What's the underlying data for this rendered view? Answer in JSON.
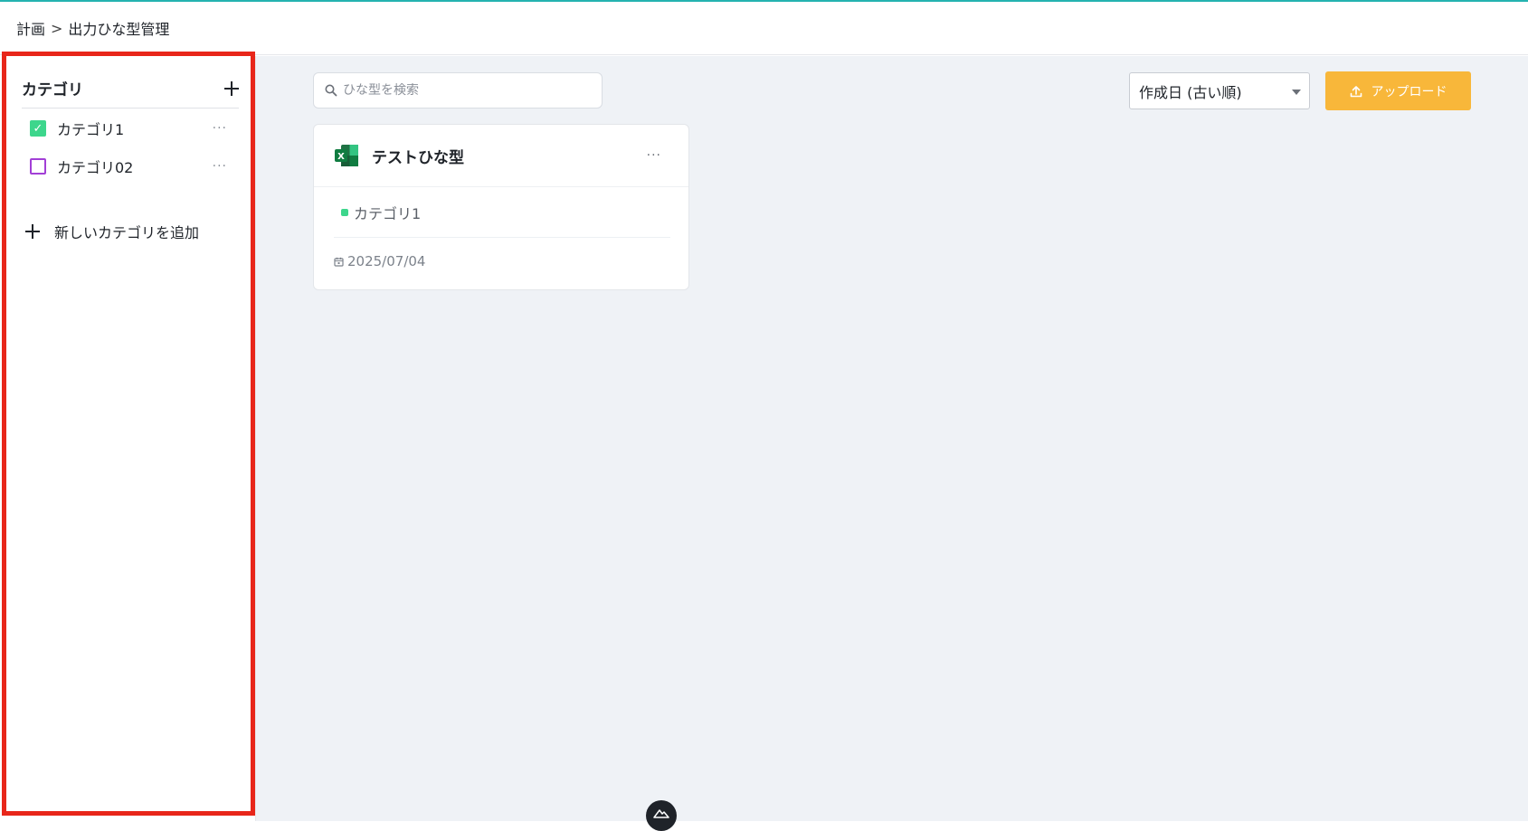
{
  "header": {
    "breadcrumb": [
      "計画",
      "出力ひな型管理"
    ],
    "separator": ">"
  },
  "sidebar": {
    "title": "カテゴリ",
    "categories": [
      {
        "label": "カテゴリ1",
        "checked": true,
        "color": "#3dd68c"
      },
      {
        "label": "カテゴリ02",
        "checked": false,
        "color": "#a23fd6"
      }
    ],
    "add_label": "新しいカテゴリを追加"
  },
  "toolbar": {
    "search_placeholder": "ひな型を検索",
    "sort_value": "作成日 (古い順)",
    "upload_label": "アップロード",
    "upload_color": "#f8b73a"
  },
  "templates": [
    {
      "title": "テストひな型",
      "file_type": "excel-icon",
      "category": "カテゴリ1",
      "date": "2025/07/04"
    }
  ],
  "highlight_color": "#e8261a"
}
